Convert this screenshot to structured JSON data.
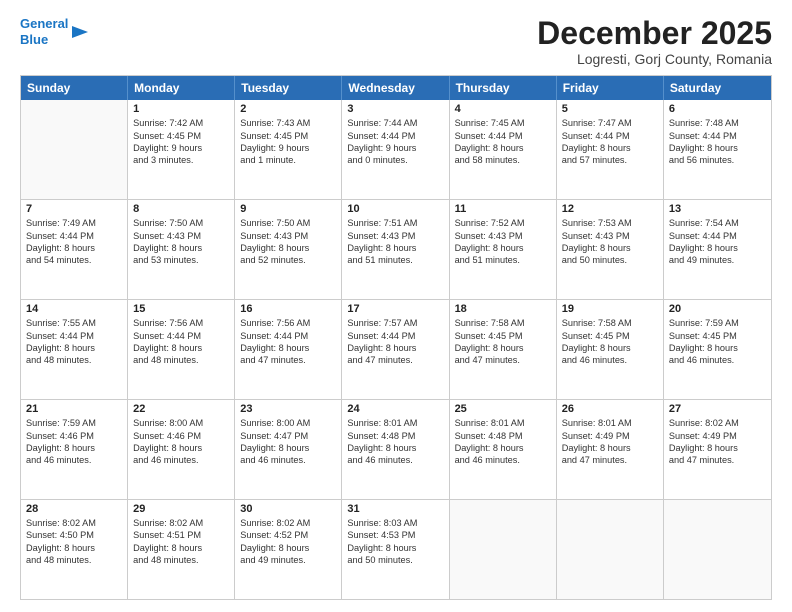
{
  "logo": {
    "line1": "General",
    "line2": "Blue"
  },
  "title": "December 2025",
  "location": "Logresti, Gorj County, Romania",
  "header_days": [
    "Sunday",
    "Monday",
    "Tuesday",
    "Wednesday",
    "Thursday",
    "Friday",
    "Saturday"
  ],
  "rows": [
    [
      {
        "day": "",
        "sunrise": "",
        "sunset": "",
        "daylight": ""
      },
      {
        "day": "1",
        "sunrise": "Sunrise: 7:42 AM",
        "sunset": "Sunset: 4:45 PM",
        "daylight": "Daylight: 9 hours and 3 minutes."
      },
      {
        "day": "2",
        "sunrise": "Sunrise: 7:43 AM",
        "sunset": "Sunset: 4:45 PM",
        "daylight": "Daylight: 9 hours and 1 minute."
      },
      {
        "day": "3",
        "sunrise": "Sunrise: 7:44 AM",
        "sunset": "Sunset: 4:44 PM",
        "daylight": "Daylight: 9 hours and 0 minutes."
      },
      {
        "day": "4",
        "sunrise": "Sunrise: 7:45 AM",
        "sunset": "Sunset: 4:44 PM",
        "daylight": "Daylight: 8 hours and 58 minutes."
      },
      {
        "day": "5",
        "sunrise": "Sunrise: 7:47 AM",
        "sunset": "Sunset: 4:44 PM",
        "daylight": "Daylight: 8 hours and 57 minutes."
      },
      {
        "day": "6",
        "sunrise": "Sunrise: 7:48 AM",
        "sunset": "Sunset: 4:44 PM",
        "daylight": "Daylight: 8 hours and 56 minutes."
      }
    ],
    [
      {
        "day": "7",
        "sunrise": "Sunrise: 7:49 AM",
        "sunset": "Sunset: 4:44 PM",
        "daylight": "Daylight: 8 hours and 54 minutes."
      },
      {
        "day": "8",
        "sunrise": "Sunrise: 7:50 AM",
        "sunset": "Sunset: 4:43 PM",
        "daylight": "Daylight: 8 hours and 53 minutes."
      },
      {
        "day": "9",
        "sunrise": "Sunrise: 7:50 AM",
        "sunset": "Sunset: 4:43 PM",
        "daylight": "Daylight: 8 hours and 52 minutes."
      },
      {
        "day": "10",
        "sunrise": "Sunrise: 7:51 AM",
        "sunset": "Sunset: 4:43 PM",
        "daylight": "Daylight: 8 hours and 51 minutes."
      },
      {
        "day": "11",
        "sunrise": "Sunrise: 7:52 AM",
        "sunset": "Sunset: 4:43 PM",
        "daylight": "Daylight: 8 hours and 51 minutes."
      },
      {
        "day": "12",
        "sunrise": "Sunrise: 7:53 AM",
        "sunset": "Sunset: 4:43 PM",
        "daylight": "Daylight: 8 hours and 50 minutes."
      },
      {
        "day": "13",
        "sunrise": "Sunrise: 7:54 AM",
        "sunset": "Sunset: 4:44 PM",
        "daylight": "Daylight: 8 hours and 49 minutes."
      }
    ],
    [
      {
        "day": "14",
        "sunrise": "Sunrise: 7:55 AM",
        "sunset": "Sunset: 4:44 PM",
        "daylight": "Daylight: 8 hours and 48 minutes."
      },
      {
        "day": "15",
        "sunrise": "Sunrise: 7:56 AM",
        "sunset": "Sunset: 4:44 PM",
        "daylight": "Daylight: 8 hours and 48 minutes."
      },
      {
        "day": "16",
        "sunrise": "Sunrise: 7:56 AM",
        "sunset": "Sunset: 4:44 PM",
        "daylight": "Daylight: 8 hours and 47 minutes."
      },
      {
        "day": "17",
        "sunrise": "Sunrise: 7:57 AM",
        "sunset": "Sunset: 4:44 PM",
        "daylight": "Daylight: 8 hours and 47 minutes."
      },
      {
        "day": "18",
        "sunrise": "Sunrise: 7:58 AM",
        "sunset": "Sunset: 4:45 PM",
        "daylight": "Daylight: 8 hours and 47 minutes."
      },
      {
        "day": "19",
        "sunrise": "Sunrise: 7:58 AM",
        "sunset": "Sunset: 4:45 PM",
        "daylight": "Daylight: 8 hours and 46 minutes."
      },
      {
        "day": "20",
        "sunrise": "Sunrise: 7:59 AM",
        "sunset": "Sunset: 4:45 PM",
        "daylight": "Daylight: 8 hours and 46 minutes."
      }
    ],
    [
      {
        "day": "21",
        "sunrise": "Sunrise: 7:59 AM",
        "sunset": "Sunset: 4:46 PM",
        "daylight": "Daylight: 8 hours and 46 minutes."
      },
      {
        "day": "22",
        "sunrise": "Sunrise: 8:00 AM",
        "sunset": "Sunset: 4:46 PM",
        "daylight": "Daylight: 8 hours and 46 minutes."
      },
      {
        "day": "23",
        "sunrise": "Sunrise: 8:00 AM",
        "sunset": "Sunset: 4:47 PM",
        "daylight": "Daylight: 8 hours and 46 minutes."
      },
      {
        "day": "24",
        "sunrise": "Sunrise: 8:01 AM",
        "sunset": "Sunset: 4:48 PM",
        "daylight": "Daylight: 8 hours and 46 minutes."
      },
      {
        "day": "25",
        "sunrise": "Sunrise: 8:01 AM",
        "sunset": "Sunset: 4:48 PM",
        "daylight": "Daylight: 8 hours and 46 minutes."
      },
      {
        "day": "26",
        "sunrise": "Sunrise: 8:01 AM",
        "sunset": "Sunset: 4:49 PM",
        "daylight": "Daylight: 8 hours and 47 minutes."
      },
      {
        "day": "27",
        "sunrise": "Sunrise: 8:02 AM",
        "sunset": "Sunset: 4:49 PM",
        "daylight": "Daylight: 8 hours and 47 minutes."
      }
    ],
    [
      {
        "day": "28",
        "sunrise": "Sunrise: 8:02 AM",
        "sunset": "Sunset: 4:50 PM",
        "daylight": "Daylight: 8 hours and 48 minutes."
      },
      {
        "day": "29",
        "sunrise": "Sunrise: 8:02 AM",
        "sunset": "Sunset: 4:51 PM",
        "daylight": "Daylight: 8 hours and 48 minutes."
      },
      {
        "day": "30",
        "sunrise": "Sunrise: 8:02 AM",
        "sunset": "Sunset: 4:52 PM",
        "daylight": "Daylight: 8 hours and 49 minutes."
      },
      {
        "day": "31",
        "sunrise": "Sunrise: 8:03 AM",
        "sunset": "Sunset: 4:53 PM",
        "daylight": "Daylight: 8 hours and 50 minutes."
      },
      {
        "day": "",
        "sunrise": "",
        "sunset": "",
        "daylight": ""
      },
      {
        "day": "",
        "sunrise": "",
        "sunset": "",
        "daylight": ""
      },
      {
        "day": "",
        "sunrise": "",
        "sunset": "",
        "daylight": ""
      }
    ]
  ]
}
